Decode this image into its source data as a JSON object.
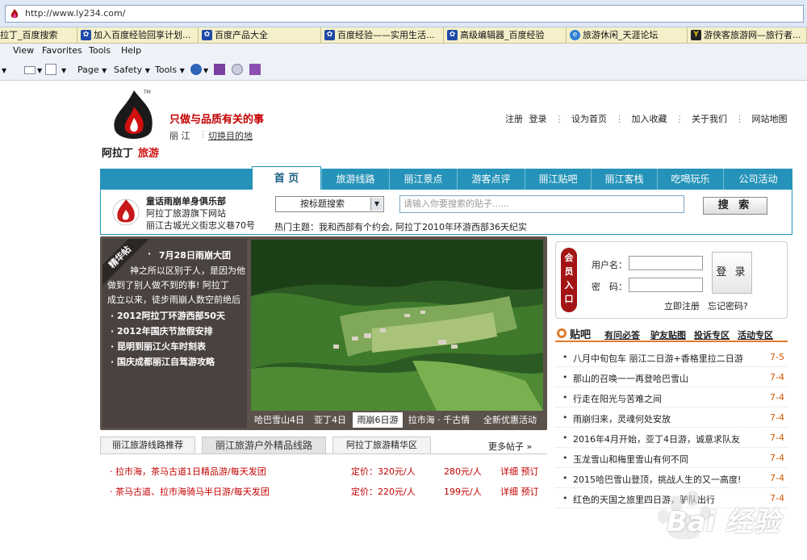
{
  "browser": {
    "url": "http://www.ly234.com/",
    "favorites": [
      "拉丁_百度搜索",
      "加入百度经验回享计划...",
      "百度产品大全",
      "百度经验——实用生活...",
      "高级编辑器_百度经验",
      "旅游休闲_天涯论坛",
      "游侠客旅游网—旅行者..."
    ],
    "menus": [
      "View",
      "Favorites",
      "Tools",
      "Help"
    ],
    "commands": {
      "page": "Page",
      "safety": "Safety",
      "tools": "Tools"
    }
  },
  "site": {
    "slogan": "只做与品质有关的事",
    "logo_text": "阿拉丁旅游",
    "city": "丽 江",
    "switch_city": "切换目的地",
    "top_links": [
      "注册",
      "登录",
      "设为首页",
      "加入收藏",
      "关于我们",
      "网站地图"
    ],
    "nav": [
      "首 页",
      "旅游线路",
      "丽江景点",
      "游客点评",
      "丽江贴吧",
      "丽江客栈",
      "吃喝玩乐",
      "公司活动"
    ],
    "club": {
      "lines": [
        "童话雨崩单身俱乐部",
        "阿拉丁旅游旗下网站",
        "丽江古城光义街忠义巷70号"
      ]
    },
    "search": {
      "select": "按标题搜索",
      "placeholder": "请输入你要搜索的贴子......",
      "button": "搜 索",
      "hot_label": "热门主题：",
      "hot_topics": "我和西部有个约会, 阿拉丁2010年环游西部36天纪实"
    },
    "featured": {
      "ribbon": "精华帖",
      "lead_title": "7月28日雨崩大团",
      "lead_body": [
        "神之所以区别于人，是因为他",
        "做到了别人做不到的事! 阿拉丁",
        "成立以来，徒步雨崩人数空前绝后"
      ],
      "items": [
        "2012阿拉丁环游西部50天",
        "2012年国庆节旅假安排",
        "昆明到丽江火车时刻表",
        "国庆成都丽江自驾游攻略"
      ],
      "photo_tabs": [
        "哈巴雪山4日",
        "亚丁4日",
        "雨崩6日游",
        "拉市海 · 千古情",
        "全新优惠活动"
      ]
    },
    "lower_tabs": [
      "丽江旅游线路推荐",
      "丽江旅游户外精品线路",
      "阿拉丁旅游精华区"
    ],
    "more_posts": "更多帖子",
    "routes": [
      {
        "name": "· 拉市海，茶马古道1日精品游/每天发团",
        "price": "定价：320元/人",
        "sale": "280元/人",
        "detail": "详细",
        "book": "预订"
      },
      {
        "name": "· 茶马古道、拉市海骑马半日游/每天发团",
        "price": "定价：220元/人",
        "sale": "199元/人",
        "detail": "详细",
        "book": "预订"
      }
    ],
    "login": {
      "badge": [
        "会",
        "员",
        "入",
        "口"
      ],
      "username_label": "用户名：",
      "password_label": "密　码：",
      "button": "登 录",
      "register": "立即注册",
      "forgot": "忘记密码?"
    },
    "forum": {
      "title": "贴吧",
      "tabs": [
        "有问必答",
        "驴友贴图",
        "投诉专区",
        "活动专区"
      ],
      "posts": [
        {
          "title": "八月中旬包车  丽江二日游+香格里拉二日游",
          "date": "7-5"
        },
        {
          "title": "那山的召唤一一再登哈巴雪山",
          "date": "7-4"
        },
        {
          "title": "行走在阳光与苦难之间",
          "date": "7-4"
        },
        {
          "title": "雨崩归来，灵魂何处安放",
          "date": "7-4"
        },
        {
          "title": "2016年4月开始，亚丁4日游，诚意求队友",
          "date": "7-4"
        },
        {
          "title": "玉龙雪山和梅里雪山有何不同",
          "date": "7-4"
        },
        {
          "title": "2015哈巴雪山登顶，挑战人生的又一高度!",
          "date": "7-4"
        },
        {
          "title": "红色的天国之旅里四日游，驴队出行",
          "date": "7-4"
        }
      ]
    },
    "watermark": "Bai 经验"
  }
}
